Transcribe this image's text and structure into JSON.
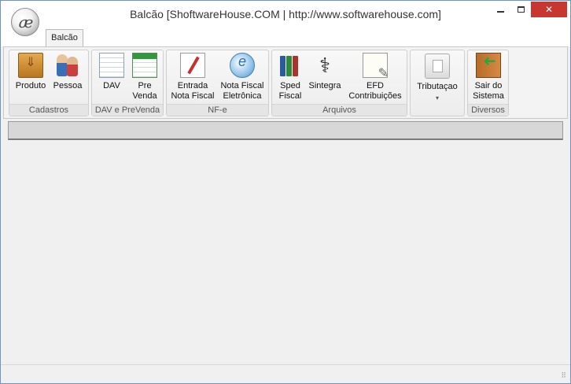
{
  "window": {
    "title": "Balcão [ShoftwareHouse.COM | http://www.softwarehouse.com]",
    "logo_text": "æ",
    "controls": {
      "close_glyph": "✕"
    }
  },
  "ribbon": {
    "tabs": [
      {
        "label": "Balcão",
        "selected": true
      }
    ],
    "groups": [
      {
        "caption": "Cadastros",
        "buttons": [
          {
            "label": "Produto",
            "icon": "box-icon"
          },
          {
            "label": "Pessoa",
            "icon": "people-icon"
          }
        ]
      },
      {
        "caption": "DAV e PreVenda",
        "buttons": [
          {
            "label": "DAV",
            "icon": "calculator-sheet-icon"
          },
          {
            "label_line1": "Pre",
            "label_line2": "Venda",
            "icon": "spreadsheet-icon"
          }
        ]
      },
      {
        "caption": "NF-e",
        "buttons": [
          {
            "label_line1": "Entrada",
            "label_line2": "Nota Fiscal",
            "icon": "pen-document-icon"
          },
          {
            "label_line1": "Nota Fiscal",
            "label_line2": "Eletrônica",
            "icon": "nfe-globe-icon"
          }
        ]
      },
      {
        "caption": "Arquivos",
        "buttons": [
          {
            "label_line1": "Sped",
            "label_line2": "Fiscal",
            "icon": "books-icon"
          },
          {
            "label": "Sintegra",
            "icon": "caduceus-icon"
          },
          {
            "label_line1": "EFD",
            "label_line2": "Contribuições",
            "icon": "edit-document-icon"
          }
        ]
      },
      {
        "caption": "",
        "buttons": [
          {
            "label": "Tributaçao",
            "icon": "tax-document-icon",
            "dropdown": true,
            "caret": "▾"
          }
        ]
      },
      {
        "caption": "Diversos",
        "buttons": [
          {
            "label_line1": "Sair do",
            "label_line2": "Sistema",
            "icon": "exit-door-icon"
          }
        ]
      }
    ]
  },
  "statusbar": {
    "grip": "⠿"
  },
  "colors": {
    "close_button": "#c7372f",
    "window_border": "#6f93c9"
  }
}
